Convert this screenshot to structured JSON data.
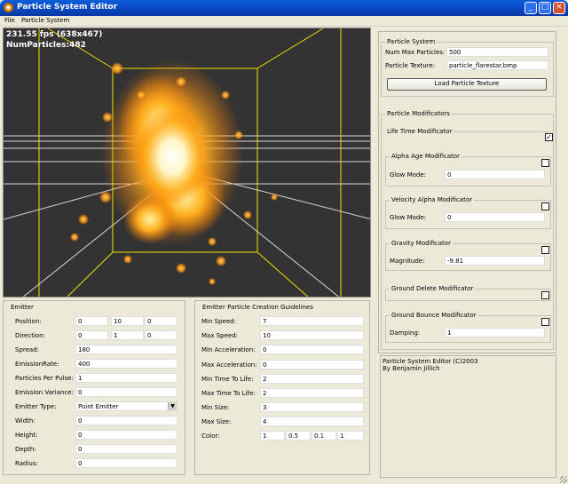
{
  "window": {
    "title": "Particle System Editor",
    "icon": "particle-flare-icon",
    "buttons": {
      "minimize": "_",
      "maximize": "□",
      "close": "×"
    }
  },
  "menu": [
    "File",
    "Particle System"
  ],
  "viewport": {
    "fps": "231.55 fps (638x467)",
    "num_particles": "NumParticles:482",
    "colors": {
      "background": "#333333",
      "box": "#f0e000",
      "grid": "#d8d8d8",
      "glow": "#ffb020"
    }
  },
  "particle_system": {
    "title": "Particle System",
    "num_max_label": "Num Max Particles:",
    "num_max_value": "500",
    "texture_label": "Particle Texture:",
    "texture_value": "particle_flarestar.bmp",
    "load_button": "Load Particle Texture"
  },
  "modificators": {
    "title": "Particle Modificators",
    "life_time": {
      "title": "Life Time Modificator",
      "checked": true
    },
    "alpha_age": {
      "title": "Alpha Age Modificator",
      "checked": false,
      "label": "Glow Mode:",
      "value": "0"
    },
    "velocity_alpha": {
      "title": "Velocity Alpha Modificator",
      "checked": false,
      "label": "Glow Mode:",
      "value": "0"
    },
    "gravity": {
      "title": "Gravity Modificator",
      "checked": false,
      "label": "Magnitude:",
      "value": "-9.81"
    },
    "ground_delete": {
      "title": "Ground Delete Modificator",
      "checked": false
    },
    "ground_bounce": {
      "title": "Ground Bounce Modificator",
      "checked": false,
      "label": "Damping:",
      "value": "1"
    }
  },
  "about": {
    "line1": "Particle System Editor (C)2003",
    "line2": "By Benjamin Jillich"
  },
  "emitter": {
    "title": "Emitter",
    "position": {
      "label": "Position:",
      "x": "0",
      "y": "10",
      "z": "0"
    },
    "direction": {
      "label": "Direction:",
      "x": "0",
      "y": "1",
      "z": "0"
    },
    "spread": {
      "label": "Spread:",
      "value": "180"
    },
    "emission_rate": {
      "label": "EmissionRate:",
      "value": "400"
    },
    "particles_per_pulse": {
      "label": "Particles Per Pulse:",
      "value": "1"
    },
    "emission_variance": {
      "label": "Emission Variance:",
      "value": "0"
    },
    "emitter_type": {
      "label": "Emitter Type:",
      "value": "Point Emitter"
    },
    "width": {
      "label": "Width:",
      "value": "0"
    },
    "height": {
      "label": "Height:",
      "value": "0"
    },
    "depth": {
      "label": "Depth:",
      "value": "0"
    },
    "radius": {
      "label": "Radius:",
      "value": "0"
    }
  },
  "guidelines": {
    "title": "Emitter Particle Creation Guidelines",
    "min_speed": {
      "label": "Min Speed:",
      "value": "7"
    },
    "max_speed": {
      "label": "Max Speed:",
      "value": "10"
    },
    "min_accel": {
      "label": "Min Acceleration:",
      "value": "0"
    },
    "max_accel": {
      "label": "Max Acceleration:",
      "value": "0"
    },
    "min_ttl": {
      "label": "Min Time To Life:",
      "value": "2"
    },
    "max_ttl": {
      "label": "Max Time To Life:",
      "value": "2"
    },
    "min_size": {
      "label": "Min Size:",
      "value": "3"
    },
    "max_size": {
      "label": "Max Size:",
      "value": "4"
    },
    "color": {
      "label": "Color:",
      "r": "1",
      "g": "0.5",
      "b": "0.1",
      "a": "1"
    }
  }
}
